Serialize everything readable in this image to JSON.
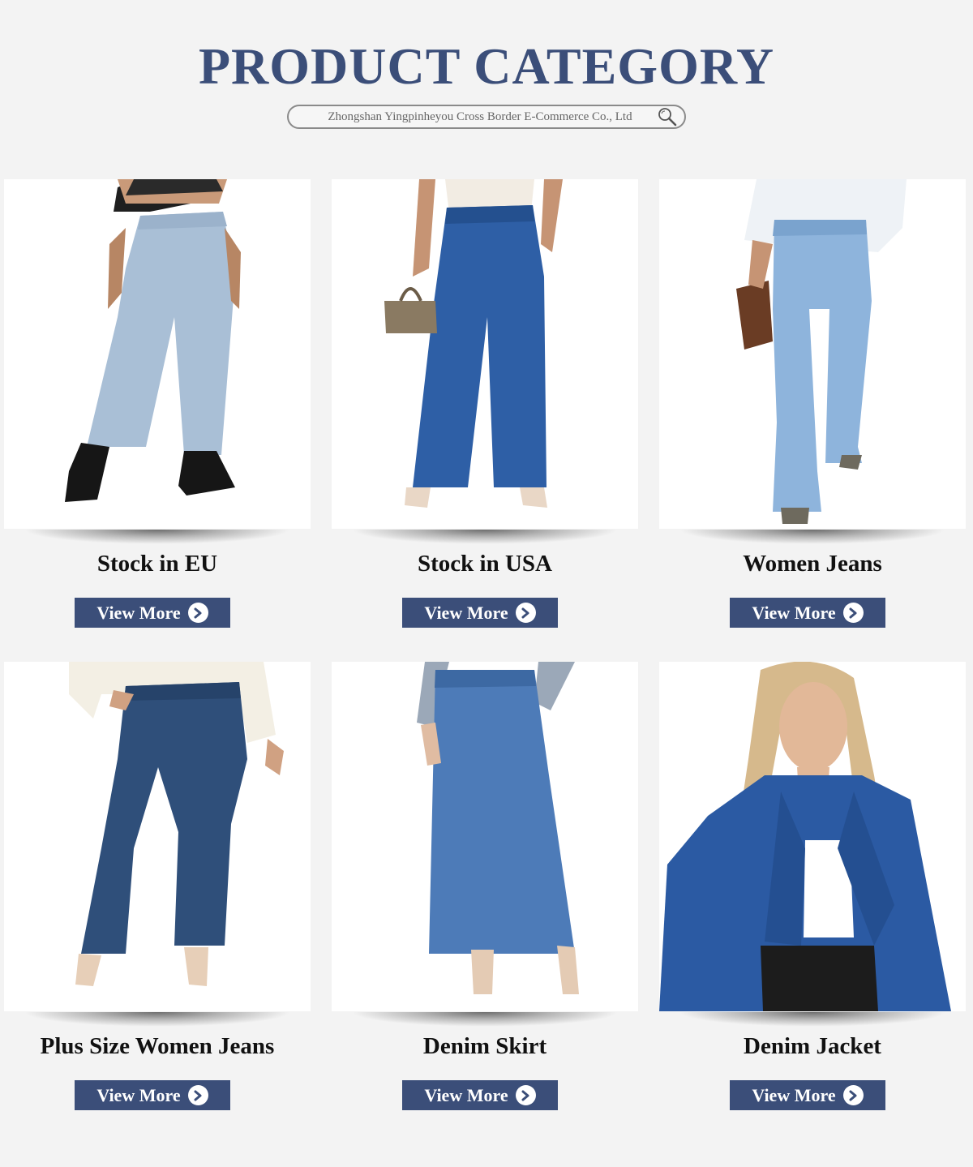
{
  "header": {
    "title": "PRODUCT CATEGORY",
    "search_text": "Zhongshan Yingpinheyou Cross Border E-Commerce Co., Ltd"
  },
  "colors": {
    "accent": "#3b4e79",
    "background": "#f3f3f3",
    "card_bg": "#ffffff"
  },
  "categories": [
    {
      "label": "Stock in EU",
      "button": "View More",
      "image": "light-wash-mom-jeans-photo"
    },
    {
      "label": "Stock in USA",
      "button": "View More",
      "image": "dark-wide-leg-jeans-photo"
    },
    {
      "label": "Women Jeans",
      "button": "View More",
      "image": "light-flare-jeans-photo"
    },
    {
      "label": "Plus Size Women Jeans",
      "button": "View More",
      "image": "dark-flare-jeans-photo"
    },
    {
      "label": "Denim Skirt",
      "button": "View More",
      "image": "denim-maxi-skirt-photo"
    },
    {
      "label": "Denim Jacket",
      "button": "View More",
      "image": "denim-jacket-photo"
    }
  ]
}
